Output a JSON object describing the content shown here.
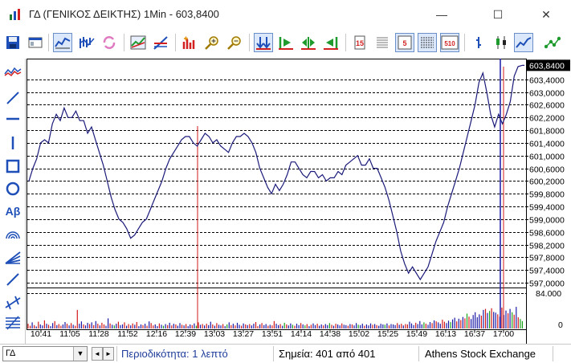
{
  "window": {
    "title": "ΓΔ (ΓΕΝΙΚΟΣ ΔΕΙΚΤΗΣ) 1Min - 603,8400",
    "minimize_glyph": "—",
    "maximize_glyph": "☐",
    "close_glyph": "✕"
  },
  "toolbar": {
    "icons": [
      "save-icon",
      "properties-icon",
      "line-chart-icon",
      "multi-chart-icon",
      "refresh-icon",
      "compare-icon",
      "indicator-icon",
      "add-series-icon",
      "zoom-in-icon",
      "zoom-out-icon",
      "scroll-both-icon",
      "scroll-right-icon",
      "fit-icon",
      "scroll-left-icon",
      "page-icon",
      "list-icon",
      "data-5-icon",
      "grid-icon",
      "data-510-icon",
      "bar-style-icon",
      "candle-style-icon",
      "line-style-icon",
      "connect-icon"
    ]
  },
  "palette": {
    "icons": [
      "chart-type-icon",
      "trendline-icon",
      "horizontal-line-icon",
      "vertical-line-icon",
      "rectangle-icon",
      "ellipse-icon",
      "text-icon",
      "arc-icon",
      "fibonacci-fan-icon",
      "line-icon",
      "andrews-fork-icon",
      "fibonacci-icon"
    ],
    "text_tool_label": "Αβ"
  },
  "colors": {
    "price_line": "#1a1a7a",
    "vol_red": "#d21919",
    "vol_blue": "#1a1aa8",
    "vol_green": "#19a319",
    "grid": "#000000",
    "badge_bg": "#000000",
    "badge_fg": "#ffffff",
    "toolbar_blue": "#1e4fb8",
    "toolbar_green": "#1f9b2e",
    "toolbar_red": "#d22020"
  },
  "chart_data": {
    "type": "line",
    "instrument": "ΓΔ",
    "interval": "1Min",
    "last_price": 603.84,
    "last_price_label": "603,8400",
    "price_ticks": [
      "603,4000",
      "603,0000",
      "602,6000",
      "602,2000",
      "601,8000",
      "601,4000",
      "601,0000",
      "600,6000",
      "600,2000",
      "599,8000",
      "599,4000",
      "599,0000",
      "598,6000",
      "598,2000",
      "597,8000",
      "597,4000",
      "597,0000"
    ],
    "price_tick_values": [
      603.4,
      603.0,
      602.6,
      602.2,
      601.8,
      601.4,
      601.0,
      600.6,
      600.2,
      599.8,
      599.4,
      599.0,
      598.6,
      598.2,
      597.8,
      597.4,
      597.0
    ],
    "volume_ticks": [
      "84.000",
      "0"
    ],
    "volume_ylim": [
      0,
      84000
    ],
    "time_ticks": [
      "10:41",
      "11:05",
      "11:28",
      "11:52",
      "12:16",
      "12:39",
      "13:03",
      "13:27",
      "13:51",
      "14:14",
      "14:38",
      "15:02",
      "15:25",
      "15:49",
      "16:13",
      "16:37",
      "17:00"
    ],
    "ylim": [
      596.9,
      603.95
    ],
    "series": [
      {
        "values": [
          600.2,
          600.6,
          600.9,
          601.4,
          601.5,
          601.4,
          602.0,
          602.3,
          602.1,
          602.5,
          602.2,
          602.2,
          602.4,
          602.1,
          602.1,
          601.7,
          601.9,
          601.5,
          601.1,
          600.7,
          600.2,
          599.7,
          599.3,
          599.0,
          598.9,
          598.7,
          598.4,
          598.5,
          598.7,
          598.9,
          599.0,
          599.3,
          599.6,
          599.9,
          600.2,
          600.6,
          600.9,
          601.1,
          601.3,
          601.5,
          601.6,
          601.6,
          601.4,
          601.3,
          601.5,
          601.7,
          601.6,
          601.4,
          601.5,
          601.3,
          601.2,
          601.1,
          601.4,
          601.6,
          601.6,
          601.7,
          601.6,
          601.4,
          601.1,
          600.6,
          600.3,
          600.0,
          599.8,
          600.1,
          599.9,
          600.1,
          600.4,
          600.8,
          600.8,
          600.6,
          600.4,
          600.3,
          600.5,
          600.5,
          600.3,
          600.4,
          600.2,
          600.3,
          600.3,
          600.5,
          600.4,
          600.7,
          600.8,
          600.9,
          601.0,
          600.7,
          600.7,
          600.9,
          600.6,
          600.6,
          600.3,
          600.0,
          599.6,
          599.1,
          598.6,
          598.0,
          597.6,
          597.3,
          597.5,
          597.3,
          597.1,
          597.3,
          597.5,
          597.9,
          598.3,
          598.6,
          598.9,
          599.4,
          599.8,
          600.2,
          600.6,
          601.1,
          601.6,
          602.1,
          602.6,
          603.3,
          603.6,
          603.0,
          602.3,
          601.9,
          602.3,
          602.0,
          602.3,
          602.7,
          603.5,
          603.8,
          603.84
        ]
      }
    ],
    "volume": {
      "colors": [
        "r",
        "r",
        "b",
        "r",
        "b",
        "r",
        "b",
        "b",
        "r",
        "b",
        "r",
        "b",
        "b",
        "r",
        "b",
        "r",
        "r",
        "b",
        "b",
        "r",
        "b",
        "r",
        "b",
        "r",
        "r",
        "b",
        "b",
        "r",
        "b",
        "b",
        "r",
        "b",
        "r",
        "b",
        "r",
        "b",
        "r",
        "r",
        "b",
        "b",
        "r",
        "b",
        "g",
        "b",
        "r",
        "b",
        "b",
        "r",
        "b",
        "r",
        "b",
        "r",
        "b",
        "r",
        "b",
        "b",
        "r",
        "b",
        "r",
        "b",
        "r",
        "r",
        "b",
        "b",
        "r",
        "b",
        "g",
        "b",
        "r",
        "b",
        "r",
        "b",
        "r",
        "b",
        "b",
        "r",
        "b",
        "r",
        "b",
        "b",
        "r",
        "b",
        "g",
        "r",
        "b",
        "r",
        "b",
        "r",
        "b",
        "b",
        "r",
        "b",
        "r",
        "b",
        "b",
        "r",
        "b",
        "g",
        "b",
        "r",
        "b",
        "r",
        "b",
        "b",
        "r",
        "b",
        "r",
        "b",
        "r",
        "b",
        "b",
        "r",
        "r",
        "b",
        "r",
        "b",
        "b",
        "r",
        "b",
        "r",
        "r",
        "b",
        "b",
        "r",
        "b",
        "g",
        "r",
        "b",
        "b",
        "g",
        "r",
        "b",
        "b",
        "r",
        "b",
        "g",
        "r",
        "b",
        "r",
        "b",
        "b",
        "r",
        "b",
        "b",
        "r",
        "b",
        "b",
        "g",
        "r",
        "b",
        "r",
        "b",
        "b",
        "r",
        "b",
        "b",
        "r",
        "b",
        "r",
        "b",
        "b",
        "g",
        "b",
        "b",
        "r",
        "b",
        "b",
        "b",
        "r",
        "b",
        "r",
        "b",
        "b",
        "b",
        "g",
        "b",
        "r",
        "b",
        "b",
        "b",
        "r",
        "b",
        "r",
        "b",
        "r",
        "r",
        "b",
        "b",
        "b",
        "r",
        "b",
        "b",
        "b",
        "g",
        "r",
        "b",
        "b",
        "r",
        "b",
        "r",
        "b",
        "b",
        "r",
        "r",
        "b",
        "b",
        "g",
        "b",
        "b",
        "r",
        "b",
        "r",
        "b",
        "r",
        "g",
        "r",
        "b",
        "b",
        "b",
        "b",
        "b",
        "r",
        "b",
        "r",
        "b",
        "g",
        "r",
        "b",
        "b",
        "r",
        "b",
        "r",
        "b",
        "b",
        "r",
        "b",
        "g",
        "r",
        "b",
        "r",
        "g",
        "g",
        "g"
      ],
      "values": [
        14,
        8,
        18,
        10,
        6,
        20,
        12,
        9,
        24,
        14,
        11,
        7,
        16,
        22,
        10,
        13,
        8,
        12,
        19,
        14,
        9,
        16,
        11,
        8,
        55,
        14,
        21,
        12,
        9,
        17,
        13,
        18,
        10,
        22,
        14,
        9,
        17,
        12,
        8,
        30,
        15,
        11,
        9,
        14,
        20,
        10,
        12,
        18,
        8,
        13,
        9,
        15,
        11,
        19,
        7,
        12,
        10,
        14,
        8,
        21,
        16,
        9,
        12,
        7,
        15,
        11,
        8,
        13,
        10,
        17,
        9,
        14,
        12,
        8,
        16,
        11,
        9,
        13,
        7,
        12,
        10,
        15,
        8,
        18,
        11,
        13,
        9,
        14,
        10,
        20,
        12,
        8,
        16,
        11,
        9,
        13,
        7,
        12,
        18,
        10,
        14,
        9,
        17,
        11,
        8,
        15,
        12,
        10,
        13,
        9,
        14,
        19,
        7,
        12,
        16,
        10,
        13,
        8,
        11,
        9,
        22,
        14,
        10,
        13,
        8,
        17,
        12,
        9,
        15,
        11,
        8,
        14,
        10,
        16,
        12,
        9,
        13,
        7,
        11,
        15,
        10,
        14,
        8,
        12,
        9,
        13,
        10,
        16,
        11,
        8,
        14,
        12,
        9,
        15,
        11,
        10,
        8,
        13,
        12,
        9,
        16,
        11,
        10,
        14,
        8,
        12,
        9,
        15,
        11,
        13,
        10,
        8,
        14,
        12,
        11,
        15,
        9,
        13,
        12,
        10,
        16,
        11,
        14,
        9,
        13,
        12,
        20,
        15,
        10,
        17,
        13,
        22,
        12,
        18,
        14,
        11,
        19,
        16,
        24,
        21,
        18,
        14,
        26,
        20,
        16,
        23,
        19,
        27,
        32,
        21,
        29,
        25,
        34,
        30,
        44,
        35,
        28,
        40,
        48,
        33,
        42,
        38,
        55,
        58,
        46,
        52,
        60,
        49,
        47,
        42,
        35,
        62,
        40,
        53,
        45,
        58,
        48,
        41,
        64,
        33,
        28,
        22
      ]
    },
    "red_spikes_volume_pct": [
      55,
      100
    ],
    "grid": "dashed horizontal",
    "legend": "none"
  },
  "statusbar": {
    "symbol": "ΓΔ",
    "dropdown_glyph": "▼",
    "prev_glyph": "◄",
    "next_glyph": "►",
    "period": "Περιοδικότητα: 1 λεπτό",
    "points": "Σημεία: 401 από 401",
    "exchange": "Athens Stock Exchange"
  }
}
